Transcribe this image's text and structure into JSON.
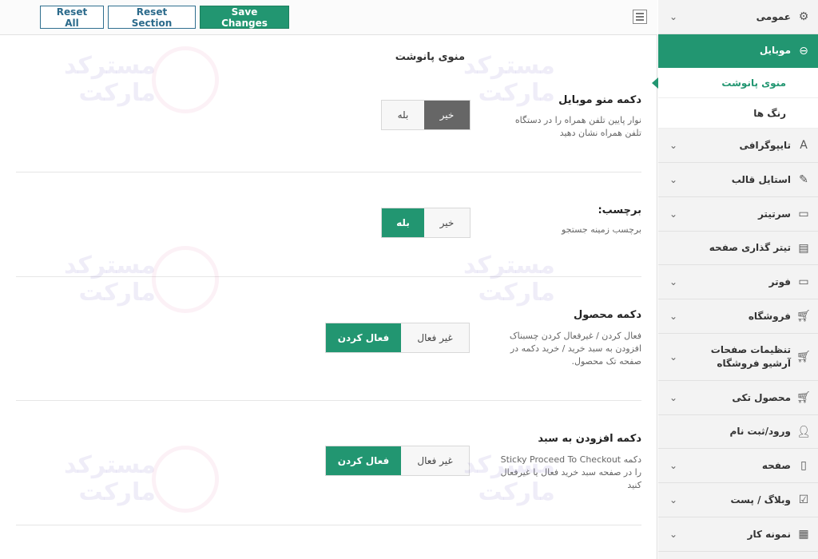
{
  "toolbar": {
    "reset_all": "Reset All",
    "reset_section": "Reset Section",
    "save_changes": "Save Changes"
  },
  "section_title": "منوی پانوشت",
  "fields": [
    {
      "title": "دکمه منو موبایل",
      "desc": "نوار پایین تلفن همراه را در دستگاه تلفن همراه نشان دهید",
      "options": [
        "خیر",
        "بله"
      ],
      "selected": "خیر"
    },
    {
      "title": "برچسب:",
      "desc": "برچسب زمینه جستجو",
      "options": [
        "خیر",
        "بله"
      ],
      "selected": "بله"
    },
    {
      "title": "دکمه محصول",
      "desc": "فعال کردن / غیرفعال کردن چسبناک افزودن به سبد خرید / خرید دکمه در صفحه تک محصول.",
      "options": [
        "غیر فعال",
        "فعال کردن"
      ],
      "selected": "فعال کردن"
    },
    {
      "title": "دکمه افزودن به سبد",
      "desc": "دکمه Sticky Proceed To Checkout را در صفحه سبد خرید فعال یا غیرفعال کنید",
      "options": [
        "غیر فعال",
        "فعال کردن"
      ],
      "selected": "فعال کردن"
    }
  ],
  "sidebar": {
    "items": [
      {
        "label": "عمومی",
        "icon": "gear-icon",
        "active": false
      },
      {
        "label": "موبایل",
        "icon": "mobile-icon",
        "active": true
      },
      {
        "label": "تایپوگرافی",
        "icon": "font-icon",
        "active": false
      },
      {
        "label": "استایل قالب",
        "icon": "brush-icon",
        "active": false
      },
      {
        "label": "سرتیتر",
        "icon": "header-icon",
        "active": false
      },
      {
        "label": "تیتر گذاری صفحه",
        "icon": "page-title-icon",
        "active": false
      },
      {
        "label": "فوتر",
        "icon": "footer-icon",
        "active": false
      },
      {
        "label": "فروشگاه",
        "icon": "cart-icon",
        "active": false
      },
      {
        "label": "تنظیمات صفحات آرشیو فروشگاه",
        "icon": "cart-icon",
        "active": false
      },
      {
        "label": "محصول تکی",
        "icon": "cart-icon",
        "active": false
      },
      {
        "label": "ورود/ثبت نام",
        "icon": "user-icon",
        "active": false
      },
      {
        "label": "صفحه",
        "icon": "page-icon",
        "active": false
      },
      {
        "label": "وبلاگ / پست",
        "icon": "edit-icon",
        "active": false
      },
      {
        "label": "نمونه کار",
        "icon": "grid-icon",
        "active": false
      }
    ],
    "subitems": [
      {
        "label": "منوی پانوشت",
        "current": true
      },
      {
        "label": "رنگ ها",
        "current": false
      }
    ]
  },
  "watermark": {
    "line1": "مسترکد",
    "line2": "مارکت"
  }
}
